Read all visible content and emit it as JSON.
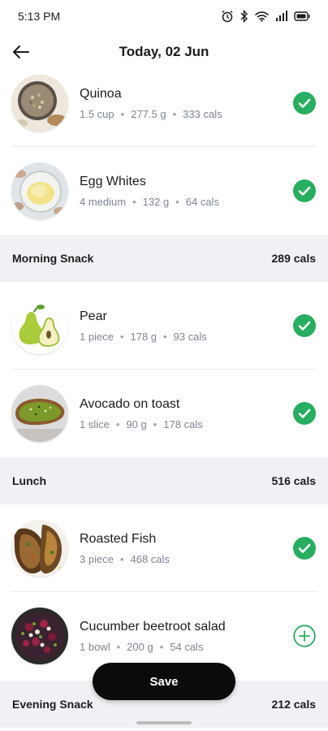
{
  "status_bar": {
    "time": "5:13 PM"
  },
  "header": {
    "title": "Today, 02 Jun"
  },
  "items": [
    {
      "name": "Quinoa",
      "meta": [
        "1.5 cup",
        "277.5 g",
        "333 cals"
      ],
      "status": "checked",
      "icon": "quinoa-photo"
    },
    {
      "name": "Egg Whites",
      "meta": [
        "4 medium",
        "132 g",
        "64 cals"
      ],
      "status": "checked",
      "icon": "egg-whites-photo"
    },
    {
      "name": "Pear",
      "meta": [
        "1 piece",
        "178 g",
        "93 cals"
      ],
      "status": "checked",
      "icon": "pear-photo"
    },
    {
      "name": "Avocado on toast",
      "meta": [
        "1 slice",
        "90 g",
        "178 cals"
      ],
      "status": "checked",
      "icon": "avocado-toast-photo"
    },
    {
      "name": "Roasted Fish",
      "meta": [
        "3 piece",
        "468 cals"
      ],
      "status": "checked",
      "icon": "roasted-fish-photo"
    },
    {
      "name": "Cucumber beetroot salad",
      "meta": [
        "1 bowl",
        "200 g",
        "54 cals"
      ],
      "status": "add",
      "icon": "salad-photo"
    }
  ],
  "sections": [
    {
      "title": "Morning Snack",
      "cals": "289 cals"
    },
    {
      "title": "Lunch",
      "cals": "516 cals"
    },
    {
      "title": "Evening Snack",
      "cals": "212 cals"
    }
  ],
  "save_label": "Save",
  "colors": {
    "accent_green": "#27ae60",
    "section_bg": "#eff1f4",
    "meta_gray": "#7c8594",
    "button_dark": "#0b0b0b"
  }
}
